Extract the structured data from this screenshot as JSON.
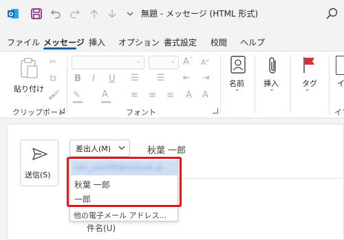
{
  "window": {
    "title": "無題 - メッセージ (HTML 形式)"
  },
  "quick_access": {
    "icons": [
      "outlook-logo",
      "save",
      "undo",
      "redo",
      "up",
      "down",
      "more"
    ]
  },
  "menu": {
    "tabs": [
      "ファイル",
      "メッセージ",
      "挿入",
      "オプション",
      "書式設定",
      "校閲",
      "ヘルプ"
    ],
    "active": "メッセージ"
  },
  "ribbon": {
    "clipboard": {
      "paste_label": "貼り付け",
      "group_label": "クリップボード"
    },
    "font": {
      "group_label": "フォント"
    },
    "names": {
      "label": "名前"
    },
    "insert": {
      "label": "挿入"
    },
    "tags": {
      "label": "タグ"
    },
    "cut_off": {
      "label_top": "イ",
      "label_bottom": "イマ"
    }
  },
  "compose": {
    "send_label": "送信(S)",
    "from_button_label": "差出人(M)",
    "from_name": "秋葉 一郎",
    "dropdown": {
      "email_blurred": "nec_user00@outlook.jp",
      "items": [
        "秋葉 一郎",
        "一郎"
      ],
      "other_address": "他の電子メール アドレス..."
    },
    "subject_label": "件名(U)"
  },
  "colors": {
    "accent": "#1a5ea8",
    "highlight_border": "#e0141e",
    "outlook_blue": "#0f6cbd",
    "tag_red": "#d13438"
  }
}
